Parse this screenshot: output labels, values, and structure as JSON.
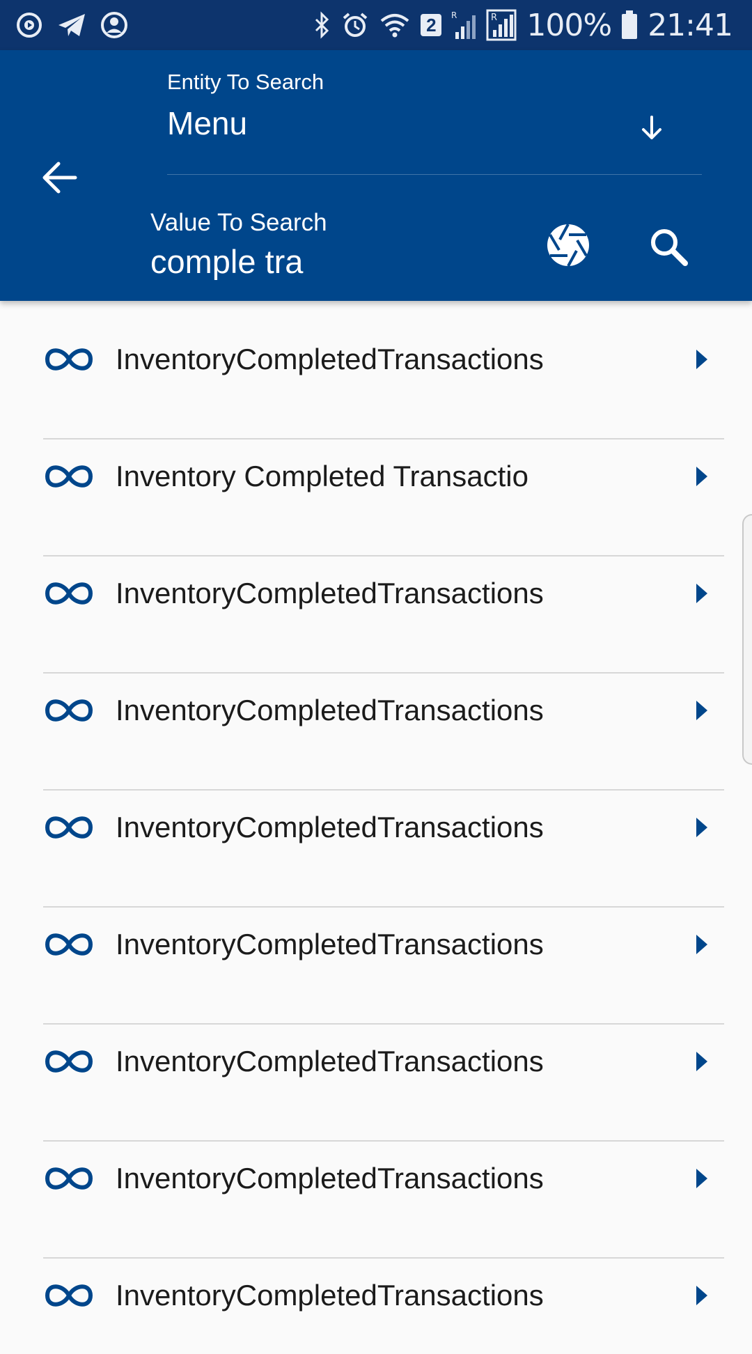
{
  "status_bar": {
    "left_icons": [
      "play-circle-icon",
      "telegram-icon",
      "account-circle-icon"
    ],
    "right_icons": [
      "bluetooth-icon",
      "alarm-icon",
      "wifi-icon",
      "sim2-icon",
      "signal-icon",
      "signal-roaming-icon",
      "battery-icon"
    ],
    "sim_badge": "2",
    "battery_percent": "100%",
    "time": "21:41"
  },
  "header": {
    "background_color": "#00468b",
    "entity_label": "Entity To Search",
    "entity_value": "Menu",
    "value_label": "Value To Search",
    "value_input": "comple tra",
    "icons": {
      "back": "arrow-left-icon",
      "dropdown": "arrow-down-icon",
      "camera": "camera-shutter-icon",
      "search": "search-icon"
    }
  },
  "results": {
    "item_icon": "link-icon",
    "chevron_icon": "chevron-right-icon",
    "accent_color": "#00468b",
    "items": [
      {
        "label": "InventoryCompletedTransactions"
      },
      {
        "label": "Inventory Completed Transactio"
      },
      {
        "label": "InventoryCompletedTransactions"
      },
      {
        "label": "InventoryCompletedTransactions"
      },
      {
        "label": "InventoryCompletedTransactions"
      },
      {
        "label": "InventoryCompletedTransactions"
      },
      {
        "label": "InventoryCompletedTransactions"
      },
      {
        "label": "InventoryCompletedTransactions"
      },
      {
        "label": "InventoryCompletedTransactions"
      }
    ]
  }
}
